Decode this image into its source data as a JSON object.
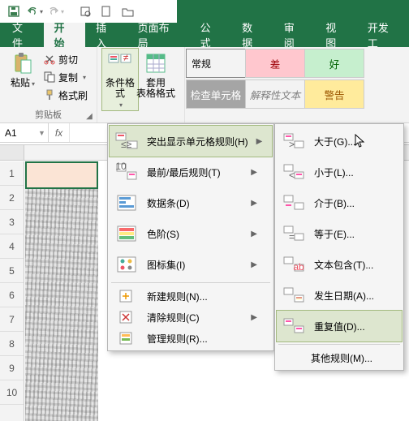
{
  "qat": {
    "save": "保存",
    "undo": "撤销",
    "redo": "重做"
  },
  "tabs": {
    "file": "文件",
    "home": "开始",
    "insert": "插入",
    "layout": "页面布局",
    "formulas": "公式",
    "data": "数据",
    "review": "审阅",
    "view": "视图",
    "dev": "开发工"
  },
  "clipboard": {
    "paste": "粘贴",
    "cut": "剪切",
    "copy": "复制",
    "format_painter": "格式刷",
    "group": "剪贴板"
  },
  "cond": {
    "cond_format": "条件格式",
    "table_format": "套用\n表格格式"
  },
  "styles": {
    "format_input": "常规",
    "check_cell": "检查单元格",
    "bad": "差",
    "good": "好",
    "explain": "解释性文本",
    "warn": "警告"
  },
  "namebox": {
    "value": "A1"
  },
  "menu1": {
    "highlight": "突出显示单元格规则(H)",
    "topbottom": "最前/最后规则(T)",
    "databars": "数据条(D)",
    "colorscales": "色阶(S)",
    "iconsets": "图标集(I)",
    "newrule": "新建规则(N)...",
    "clear": "清除规则(C)",
    "manage": "管理规则(R)..."
  },
  "menu2": {
    "greater": "大于(G)...",
    "less": "小于(L)...",
    "between": "介于(B)...",
    "equal": "等于(E)...",
    "textcontains": "文本包含(T)...",
    "dateoccurs": "发生日期(A)...",
    "duplicate": "重复值(D)...",
    "more": "其他规则(M)..."
  },
  "rows": [
    "1",
    "2",
    "3",
    "4",
    "5",
    "6",
    "7",
    "8",
    "9",
    "10"
  ]
}
